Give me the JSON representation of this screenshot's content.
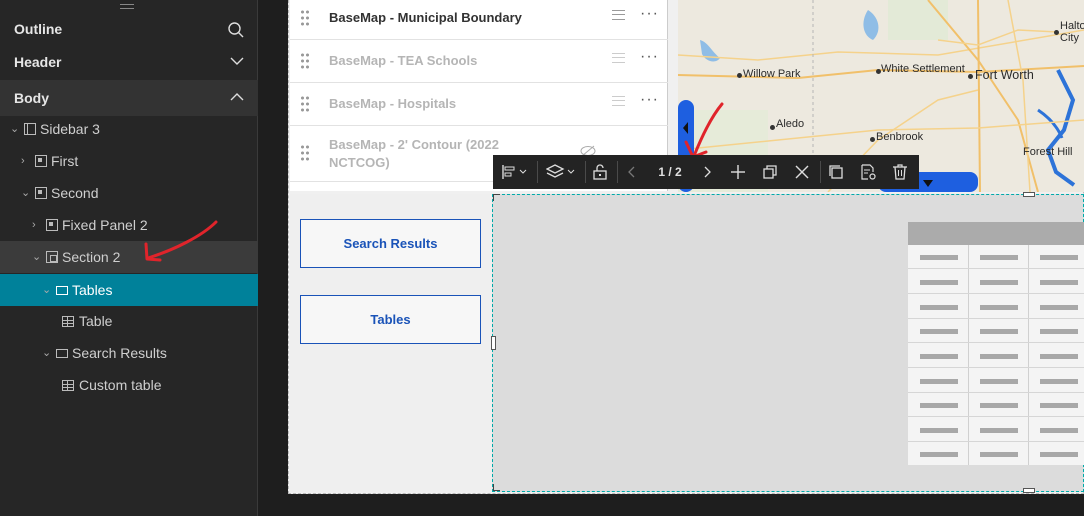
{
  "outline": {
    "title": "Outline",
    "header_label": "Header",
    "body_label": "Body",
    "tree": [
      {
        "label": "Sidebar 3",
        "level": 0
      },
      {
        "label": "First",
        "level": 1
      },
      {
        "label": "Second",
        "level": 1
      },
      {
        "label": "Fixed Panel 2",
        "level": 2
      },
      {
        "label": "Section 2",
        "level": 2
      },
      {
        "label": "Tables",
        "level": 3,
        "selected": true
      },
      {
        "label": "Table",
        "level": 4
      },
      {
        "label": "Search Results",
        "level": 3
      },
      {
        "label": "Custom table",
        "level": 4
      }
    ]
  },
  "layers": [
    {
      "name": "BaseMap - Municipal Boundary",
      "dim": false
    },
    {
      "name": "BaseMap - TEA Schools",
      "dim": true
    },
    {
      "name": "BaseMap - Hospitals",
      "dim": true
    },
    {
      "name": "BaseMap - 2' Contour (2022 NCTCOG)",
      "dim": true
    }
  ],
  "map": {
    "labels": [
      "Haltom City",
      "Willow Park",
      "White Settlement",
      "Fort Worth",
      "Aledo",
      "Benbrook",
      "Forest Hill"
    ]
  },
  "toolbar": {
    "page_indicator": "1 / 2"
  },
  "sidebar_buttons": {
    "search_results": "Search Results",
    "tables": "Tables"
  },
  "colors": {
    "selected_bg": "#00819a",
    "button_accent": "#1a53b8",
    "annotation_red": "#e0242b"
  }
}
